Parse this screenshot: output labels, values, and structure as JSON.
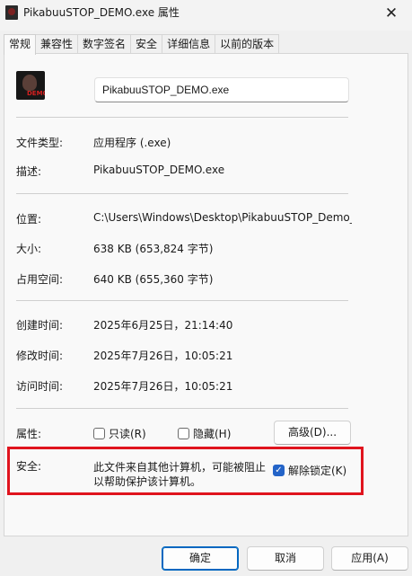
{
  "window": {
    "title": "PikabuuSTOP_DEMO.exe 属性",
    "close_glyph": "✕"
  },
  "tabs": [
    {
      "label": "常规",
      "active": true
    },
    {
      "label": "兼容性"
    },
    {
      "label": "数字签名"
    },
    {
      "label": "安全"
    },
    {
      "label": "详细信息"
    },
    {
      "label": "以前的版本"
    }
  ],
  "file": {
    "icon_label": "DEMO",
    "name": "PikabuuSTOP_DEMO.exe"
  },
  "fields": {
    "type": {
      "label": "文件类型:",
      "value": "应用程序 (.exe)"
    },
    "description": {
      "label": "描述:",
      "value": "PikabuuSTOP_DEMO.exe"
    },
    "location": {
      "label": "位置:",
      "value": "C:\\Users\\Windows\\Desktop\\PikabuuSTOP_Demo_"
    },
    "size": {
      "label": "大小:",
      "value": "638 KB (653,824 字节)"
    },
    "size_on_disk": {
      "label": "占用空间:",
      "value": "640 KB (655,360 字节)"
    },
    "created": {
      "label": "创建时间:",
      "value": "2025年6月25日，21:14:40"
    },
    "modified": {
      "label": "修改时间:",
      "value": "2025年7月26日，10:05:21"
    },
    "accessed": {
      "label": "访问时间:",
      "value": "2025年7月26日，10:05:21"
    }
  },
  "attributes": {
    "label": "属性:",
    "readonly": {
      "label": "只读(R)",
      "checked": false
    },
    "hidden": {
      "label": "隐藏(H)",
      "checked": false
    },
    "advanced_label": "高级(D)..."
  },
  "security": {
    "label": "安全:",
    "message_line1": "此文件来自其他计算机，可能被阻止",
    "message_line2": "以帮助保护该计算机。",
    "unblock": {
      "label": "解除锁定(K)",
      "checked": true
    }
  },
  "buttons": {
    "ok": "确定",
    "cancel": "取消",
    "apply": "应用(A)"
  },
  "colors": {
    "accent": "#0067c0",
    "highlight_box": "#e0141e",
    "checkbox_checked": "#2464c8"
  }
}
